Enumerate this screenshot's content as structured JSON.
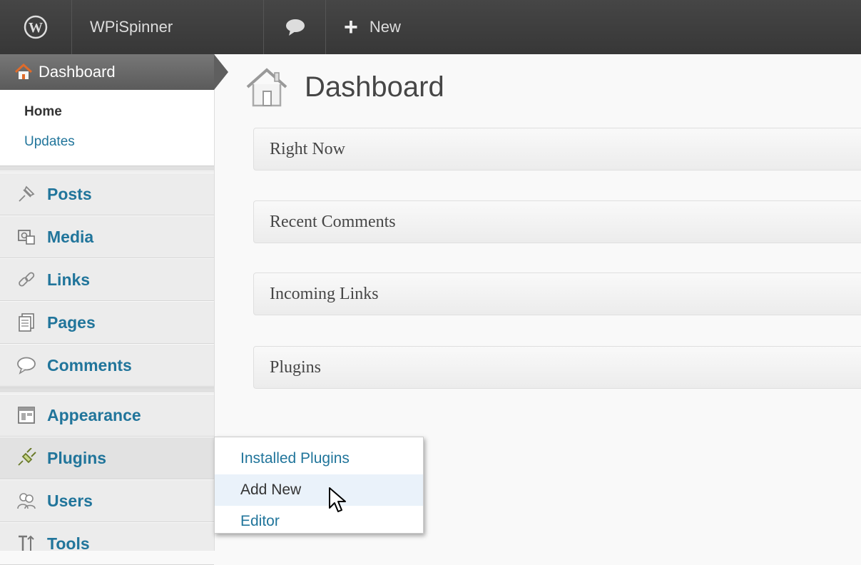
{
  "adminbar": {
    "site_name": "WPiSpinner",
    "new_label": "New",
    "new_plus": "+"
  },
  "sidebar": {
    "dashboard_label": "Dashboard",
    "dashboard_submenu": [
      "Home",
      "Updates"
    ],
    "items": [
      {
        "label": "Posts",
        "icon": "pin-icon"
      },
      {
        "label": "Media",
        "icon": "media-icon"
      },
      {
        "label": "Links",
        "icon": "link-icon"
      },
      {
        "label": "Pages",
        "icon": "pages-icon"
      },
      {
        "label": "Comments",
        "icon": "comment-icon"
      },
      {
        "label": "Appearance",
        "icon": "appearance-icon"
      },
      {
        "label": "Plugins",
        "icon": "plugin-icon"
      },
      {
        "label": "Users",
        "icon": "users-icon"
      },
      {
        "label": "Tools",
        "icon": "tools-icon"
      }
    ]
  },
  "main": {
    "title": "Dashboard",
    "boxes": [
      "Right Now",
      "Recent Comments",
      "Incoming Links",
      "Plugins"
    ]
  },
  "plugins_flyout": {
    "items": [
      "Installed Plugins",
      "Add New",
      "Editor"
    ],
    "hovered": "Add New"
  },
  "colors": {
    "link": "#21759b",
    "adminbar": "#464646"
  }
}
